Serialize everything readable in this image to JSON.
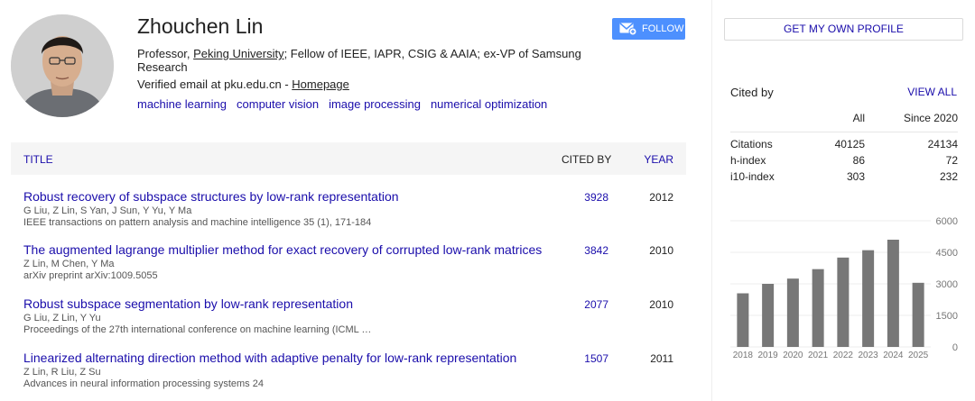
{
  "profile": {
    "name": "Zhouchen Lin",
    "affiliation_prefix": "Professor, ",
    "affiliation_link": "Peking University",
    "affiliation_suffix": "; Fellow of IEEE, IAPR, CSIG & AAIA; ex-VP of Samsung Research",
    "email_text": "Verified email at pku.edu.cn - ",
    "homepage_label": "Homepage",
    "interests": [
      "machine learning",
      "computer vision",
      "image processing",
      "numerical optimization"
    ],
    "follow_label": "FOLLOW"
  },
  "table": {
    "title_header": "TITLE",
    "cited_header": "CITED BY",
    "year_header": "YEAR",
    "rows": [
      {
        "title": "Robust recovery of subspace structures by low-rank representation",
        "authors": "G Liu, Z Lin, S Yan, J Sun, Y Yu, Y Ma",
        "venue": "IEEE transactions on pattern analysis and machine intelligence 35 (1), 171-184",
        "cited": "3928",
        "year": "2012"
      },
      {
        "title": "The augmented lagrange multiplier method for exact recovery of corrupted low-rank matrices",
        "authors": "Z Lin, M Chen, Y Ma",
        "venue": "arXiv preprint arXiv:1009.5055",
        "cited": "3842",
        "year": "2010"
      },
      {
        "title": "Robust subspace segmentation by low-rank representation",
        "authors": "G Liu, Z Lin, Y Yu",
        "venue": "Proceedings of the 27th international conference on machine learning (ICML …",
        "cited": "2077",
        "year": "2010"
      },
      {
        "title": "Linearized alternating direction method with adaptive penalty for low-rank representation",
        "authors": "Z Lin, R Liu, Z Su",
        "venue": "Advances in neural information processing systems 24",
        "cited": "1507",
        "year": "2011"
      }
    ]
  },
  "sidebar": {
    "get_profile_label": "GET MY OWN PROFILE",
    "cited_by_label": "Cited by",
    "view_all_label": "VIEW ALL",
    "col_all": "All",
    "col_since": "Since 2020",
    "stats": [
      {
        "label": "Citations",
        "all": "40125",
        "since": "24134"
      },
      {
        "label": "h-index",
        "all": "86",
        "since": "72"
      },
      {
        "label": "i10-index",
        "all": "303",
        "since": "232"
      }
    ]
  },
  "colors": {
    "link": "#1a0dab",
    "bar": "#777777",
    "follow_bg": "#4d90fe"
  },
  "chart_data": {
    "type": "bar",
    "categories": [
      "2018",
      "2019",
      "2020",
      "2021",
      "2022",
      "2023",
      "2024",
      "2025"
    ],
    "values": [
      2550,
      3000,
      3250,
      3700,
      4250,
      4600,
      5100,
      3050
    ],
    "yticks": [
      0,
      1500,
      3000,
      4500,
      6000
    ],
    "ylim": [
      0,
      6000
    ],
    "grid": true,
    "title": "",
    "xlabel": "",
    "ylabel": ""
  }
}
